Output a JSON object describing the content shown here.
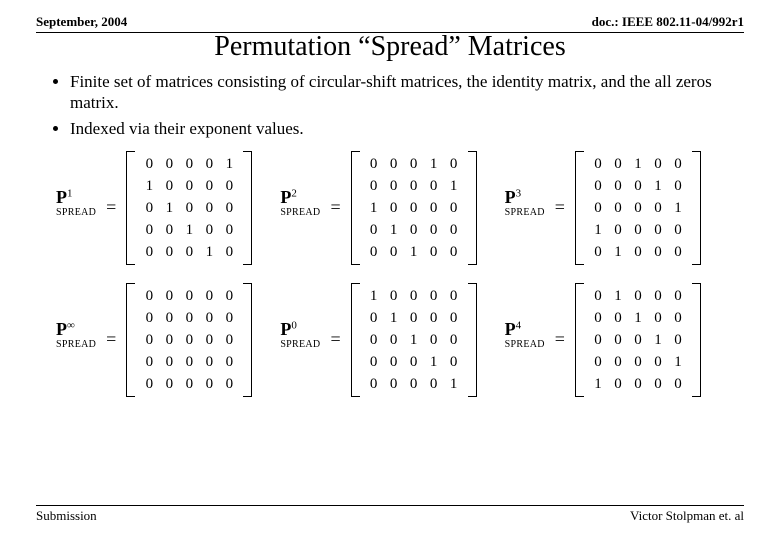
{
  "header": {
    "date_label": "September, 2004",
    "doc_ref": "doc.: IEEE 802.11-04/992r1"
  },
  "title": "Permutation “Spread” Matrices",
  "bullets": [
    "Finite set of matrices consisting of circular-shift matrices, the identity matrix, and the all zeros matrix.",
    "Indexed via their exponent values."
  ],
  "labels": {
    "p": "P",
    "sub": "SPREAD",
    "eq": "=",
    "sup1": "1",
    "sup2": "2",
    "sup3": "3",
    "supInf": "∞",
    "sup0": "0",
    "sup4": "4"
  },
  "matrices": {
    "m1": [
      [
        0,
        0,
        0,
        0,
        1
      ],
      [
        1,
        0,
        0,
        0,
        0
      ],
      [
        0,
        1,
        0,
        0,
        0
      ],
      [
        0,
        0,
        1,
        0,
        0
      ],
      [
        0,
        0,
        0,
        1,
        0
      ]
    ],
    "m2": [
      [
        0,
        0,
        0,
        1,
        0
      ],
      [
        0,
        0,
        0,
        0,
        1
      ],
      [
        1,
        0,
        0,
        0,
        0
      ],
      [
        0,
        1,
        0,
        0,
        0
      ],
      [
        0,
        0,
        1,
        0,
        0
      ]
    ],
    "m3": [
      [
        0,
        0,
        1,
        0,
        0
      ],
      [
        0,
        0,
        0,
        1,
        0
      ],
      [
        0,
        0,
        0,
        0,
        1
      ],
      [
        1,
        0,
        0,
        0,
        0
      ],
      [
        0,
        1,
        0,
        0,
        0
      ]
    ],
    "mInf": [
      [
        0,
        0,
        0,
        0,
        0
      ],
      [
        0,
        0,
        0,
        0,
        0
      ],
      [
        0,
        0,
        0,
        0,
        0
      ],
      [
        0,
        0,
        0,
        0,
        0
      ],
      [
        0,
        0,
        0,
        0,
        0
      ]
    ],
    "m0": [
      [
        1,
        0,
        0,
        0,
        0
      ],
      [
        0,
        1,
        0,
        0,
        0
      ],
      [
        0,
        0,
        1,
        0,
        0
      ],
      [
        0,
        0,
        0,
        1,
        0
      ],
      [
        0,
        0,
        0,
        0,
        1
      ]
    ],
    "m4": [
      [
        0,
        1,
        0,
        0,
        0
      ],
      [
        0,
        0,
        1,
        0,
        0
      ],
      [
        0,
        0,
        0,
        1,
        0
      ],
      [
        0,
        0,
        0,
        0,
        1
      ],
      [
        1,
        0,
        0,
        0,
        0
      ]
    ]
  },
  "footer": {
    "left": "Submission",
    "right": "Victor Stolpman et. al"
  }
}
